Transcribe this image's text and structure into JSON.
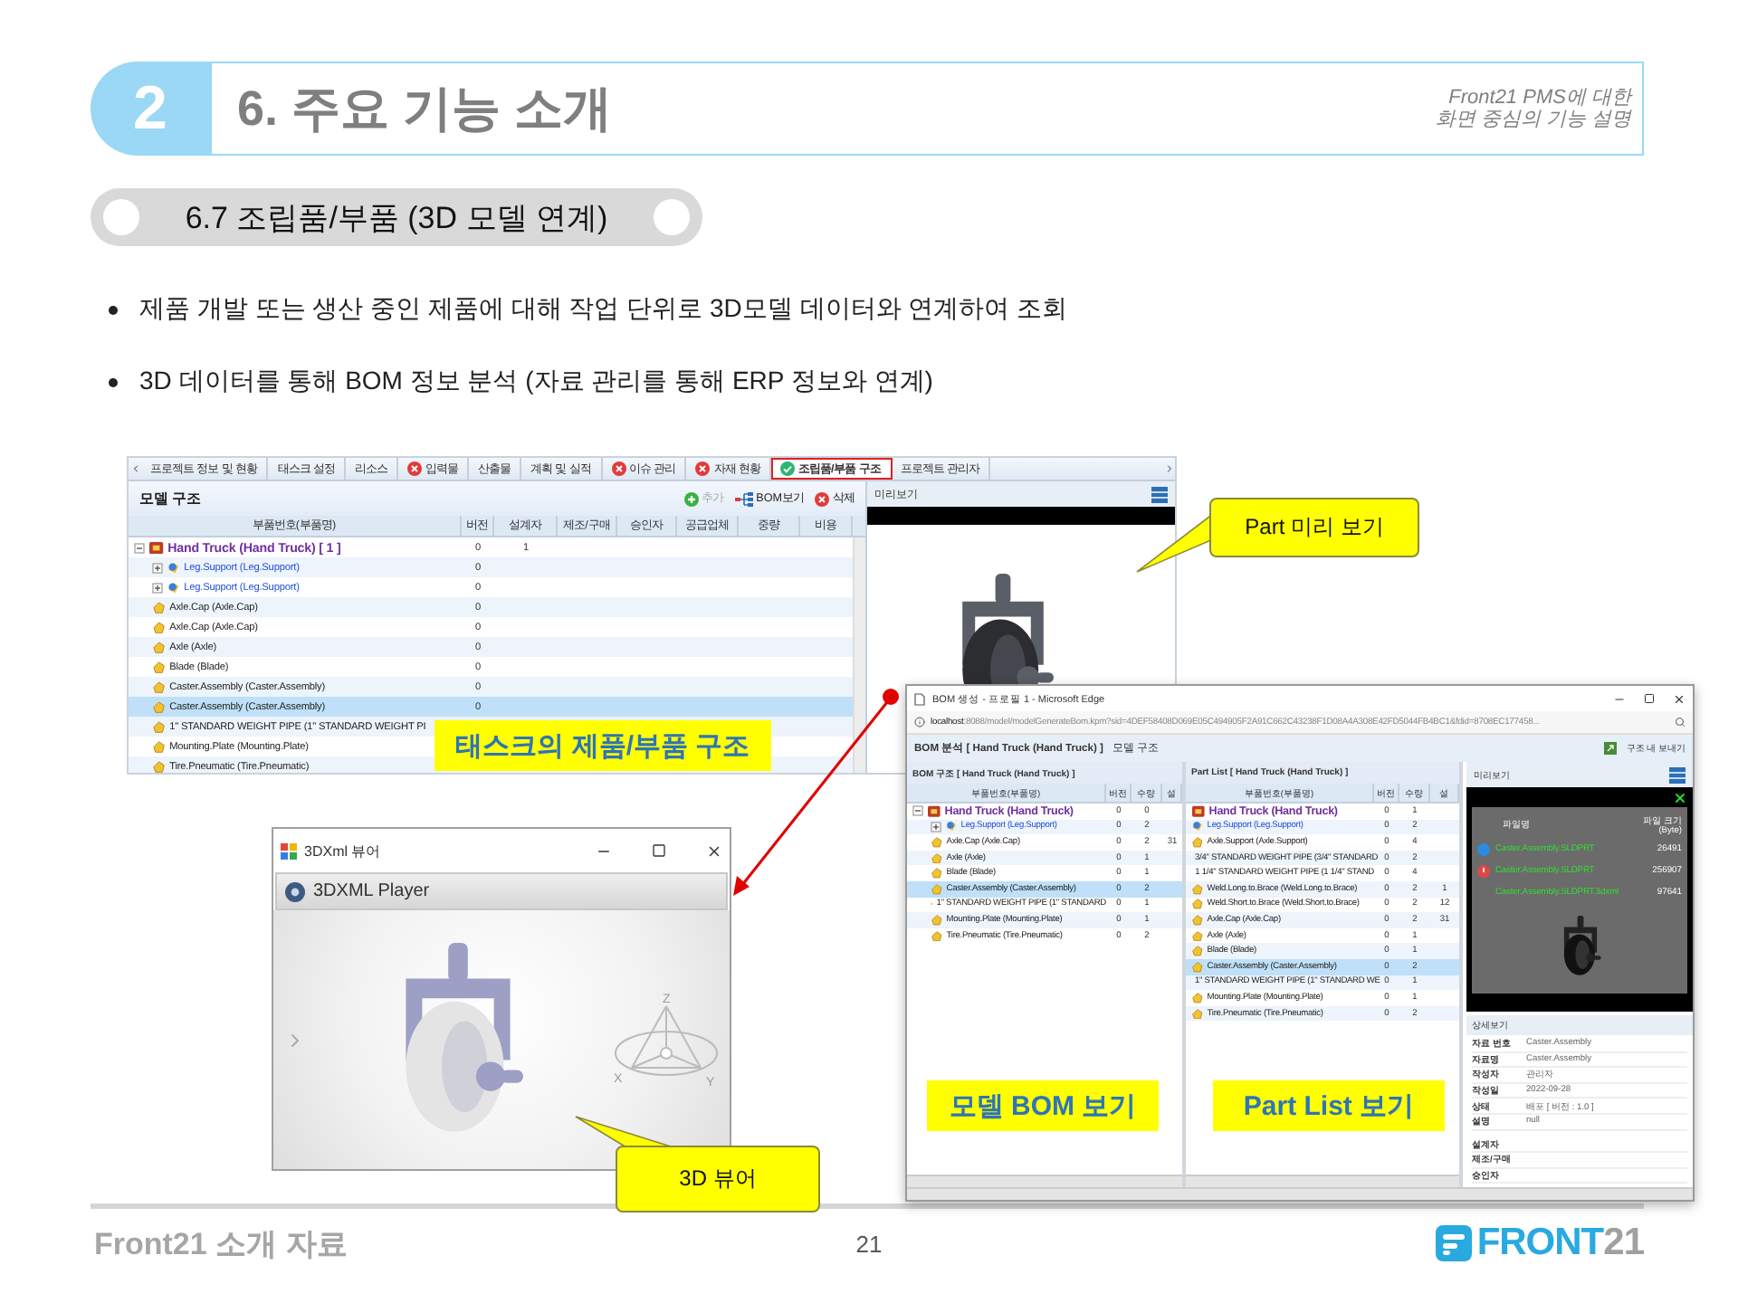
{
  "header": {
    "number": "2",
    "title": "6. 주요 기능 소개",
    "subtitle_lines": [
      "Front21 PMS에 대한",
      "화면 중심의 기능 설명"
    ]
  },
  "section": {
    "title": "6.7 조립품/부품 (3D 모델 연계)"
  },
  "bullets": [
    "제품 개발 또는 생산 중인 제품에 대해 작업 단위로 3D모델 데이터와 연계하여 조회",
    "3D 데이터를 통해 BOM 정보 분석 (자료 관리를 통해 ERP 정보와 연계)"
  ],
  "task_screen": {
    "tabs": [
      {
        "label": "프로젝트 정보 및 현황",
        "kind": "plain",
        "selected": false
      },
      {
        "label": "태스크 설정",
        "kind": "plain",
        "selected": false
      },
      {
        "label": "리소스",
        "kind": "plain",
        "selected": false
      },
      {
        "label": "입력물",
        "kind": "error",
        "selected": false
      },
      {
        "label": "산출물",
        "kind": "plain",
        "selected": false
      },
      {
        "label": "계획 및 실적",
        "kind": "plain",
        "selected": false
      },
      {
        "label": "이슈 관리",
        "kind": "error",
        "selected": false
      },
      {
        "label": "자재 현황",
        "kind": "error",
        "selected": false
      },
      {
        "label": "조립품/부품 구조",
        "kind": "done",
        "selected": true
      },
      {
        "label": "프로젝트 관리자",
        "kind": "plain",
        "selected": false
      }
    ],
    "panel_title": "모델 구조",
    "actions": [
      {
        "label": "추가",
        "kind": "add",
        "disabled": true
      },
      {
        "label": "BOM보기",
        "kind": "tree",
        "disabled": false
      },
      {
        "label": "삭제",
        "kind": "delete",
        "disabled": false
      }
    ],
    "name_column": "부품번호(부품명)",
    "columns": [
      "버전",
      "설계자",
      "제조/구매",
      "승인자",
      "공급업체",
      "중량",
      "비용"
    ],
    "tree": [
      {
        "name": "Hand Truck (Hand Truck) [ 1 ]",
        "kind": "root",
        "expanded": true,
        "selected": false,
        "cells": [
          "0",
          "1"
        ],
        "children": [
          {
            "name": "Leg.Support (Leg.Support)",
            "kind": "assembly",
            "expanded": false,
            "selected": false,
            "cells": [
              "0"
            ]
          },
          {
            "name": "Leg.Support (Leg.Support)",
            "kind": "assembly",
            "expanded": false,
            "selected": false,
            "cells": [
              "0"
            ]
          },
          {
            "name": "Axle.Cap (Axle.Cap)",
            "kind": "part",
            "selected": false,
            "cells": [
              "0"
            ]
          },
          {
            "name": "Axle.Cap (Axle.Cap)",
            "kind": "part",
            "selected": false,
            "cells": [
              "0"
            ]
          },
          {
            "name": "Axle (Axle)",
            "kind": "part",
            "selected": false,
            "cells": [
              "0"
            ]
          },
          {
            "name": "Blade (Blade)",
            "kind": "part",
            "selected": false,
            "cells": [
              "0"
            ]
          },
          {
            "name": "Caster.Assembly (Caster.Assembly)",
            "kind": "part",
            "selected": false,
            "cells": [
              "0"
            ]
          },
          {
            "name": "Caster.Assembly (Caster.Assembly)",
            "kind": "part",
            "selected": true,
            "cells": [
              "0"
            ]
          },
          {
            "name": "1\" STANDARD WEIGHT PIPE (1\" STANDARD WEIGHT PI",
            "kind": "part",
            "selected": false
          },
          {
            "name": "Mounting.Plate (Mounting.Plate)",
            "kind": "part",
            "selected": false
          },
          {
            "name": "Tire.Pneumatic (Tire.Pneumatic)",
            "kind": "part",
            "selected": false
          }
        ]
      }
    ],
    "preview_title": "미리보기"
  },
  "bom_window": {
    "title": "BOM 생성 - 프로필 1 - Microsoft Edge",
    "url_host": "localhost",
    "url_path": ":8088/model/modelGenerateBom.kpm?sid=4DEF58408D069E05C494905F2A91C662C43238F1D08A4A308E42FD5044FB4BC1&fdid=8708EC177458...",
    "heading": "BOM 분석 [ Hand Truck (Hand Truck) ]",
    "heading_sub": "모델 구조",
    "export_label": "구조 내 보내기",
    "bom_panel": {
      "title": "BOM 구조 [ Hand Truck (Hand Truck) ]",
      "name_column": "부품번호(부품명)",
      "columns": [
        "버전",
        "수량",
        "설"
      ],
      "tree": [
        {
          "name": "Hand Truck (Hand Truck)",
          "kind": "root",
          "expanded": true,
          "selected": false,
          "cells": [
            "0",
            "0"
          ],
          "children": [
            {
              "name": "Leg.Support (Leg.Support)",
              "kind": "assembly",
              "expanded": false,
              "selected": false,
              "cells": [
                "0",
                "2"
              ]
            },
            {
              "name": "Axle.Cap (Axle.Cap)",
              "kind": "part",
              "selected": false,
              "cells": [
                "0",
                "2",
                "31"
              ]
            },
            {
              "name": "Axle (Axle)",
              "kind": "part",
              "selected": false,
              "cells": [
                "0",
                "1"
              ]
            },
            {
              "name": "Blade (Blade)",
              "kind": "part",
              "selected": false,
              "cells": [
                "0",
                "1"
              ]
            },
            {
              "name": "Caster.Assembly (Caster.Assembly)",
              "kind": "part",
              "selected": true,
              "cells": [
                "0",
                "2"
              ]
            },
            {
              "name": "1\" STANDARD WEIGHT PIPE (1\" STANDARD",
              "kind": "part",
              "selected": false,
              "cells": [
                "0",
                "1"
              ]
            },
            {
              "name": "Mounting.Plate (Mounting.Plate)",
              "kind": "part",
              "selected": false,
              "cells": [
                "0",
                "1"
              ]
            },
            {
              "name": "Tire.Pneumatic (Tire.Pneumatic)",
              "kind": "part",
              "selected": false,
              "cells": [
                "0",
                "2"
              ]
            }
          ]
        }
      ]
    },
    "part_panel": {
      "title": "Part List [ Hand Truck (Hand Truck) ]",
      "name_column": "부품번호(부품명)",
      "columns": [
        "버전",
        "수량",
        "설"
      ],
      "rows": [
        {
          "name": "Hand Truck (Hand Truck)",
          "kind": "root",
          "selected": false,
          "cells": [
            "0",
            "1"
          ]
        },
        {
          "name": "Leg.Support (Leg.Support)",
          "kind": "assembly",
          "selected": false,
          "cells": [
            "0",
            "2"
          ]
        },
        {
          "name": "Axle.Support (Axle.Support)",
          "kind": "part",
          "selected": false,
          "cells": [
            "0",
            "4"
          ]
        },
        {
          "name": "3/4\" STANDARD WEIGHT PIPE (3/4\" STANDARD",
          "kind": "part",
          "selected": false,
          "cells": [
            "0",
            "2"
          ]
        },
        {
          "name": "1 1/4\" STANDARD WEIGHT PIPE (1 1/4\" STAND",
          "kind": "part",
          "selected": false,
          "cells": [
            "0",
            "4"
          ]
        },
        {
          "name": "Weld.Long.to.Brace (Weld.Long.to.Brace)",
          "kind": "part",
          "selected": false,
          "cells": [
            "0",
            "2",
            "1"
          ]
        },
        {
          "name": "Weld.Short.to.Brace (Weld.Short.to.Brace)",
          "kind": "part",
          "selected": false,
          "cells": [
            "0",
            "2",
            "12"
          ]
        },
        {
          "name": "Axle.Cap (Axle.Cap)",
          "kind": "part",
          "selected": false,
          "cells": [
            "0",
            "2",
            "31"
          ]
        },
        {
          "name": "Axle (Axle)",
          "kind": "part",
          "selected": false,
          "cells": [
            "0",
            "1"
          ]
        },
        {
          "name": "Blade (Blade)",
          "kind": "part",
          "selected": false,
          "cells": [
            "0",
            "1"
          ]
        },
        {
          "name": "Caster.Assembly (Caster.Assembly)",
          "kind": "part",
          "selected": true,
          "cells": [
            "0",
            "2"
          ]
        },
        {
          "name": "1\" STANDARD WEIGHT PIPE (1\" STANDARD WE",
          "kind": "part",
          "selected": false,
          "cells": [
            "0",
            "1"
          ]
        },
        {
          "name": "Mounting.Plate (Mounting.Plate)",
          "kind": "part",
          "selected": false,
          "cells": [
            "0",
            "1"
          ]
        },
        {
          "name": "Tire.Pneumatic (Tire.Pneumatic)",
          "kind": "part",
          "selected": false,
          "cells": [
            "0",
            "2"
          ]
        }
      ]
    },
    "preview": {
      "title": "미리보기",
      "file_columns": [
        "파일명",
        "파일 크기 (Byte)"
      ],
      "files": [
        {
          "name": "Caster.Assembly.SLDPRT",
          "size": "26491",
          "kind": "model"
        },
        {
          "name": "Caster.Assembly.SLDPRT",
          "size": "256907",
          "kind": "alert"
        },
        {
          "name": "Caster.Assembly.SLDPRT.3dxml",
          "size": "97641",
          "kind": "plain"
        }
      ]
    },
    "details": {
      "title": "상세보기",
      "fields": [
        {
          "label": "자료 번호",
          "value": "Caster.Assembly"
        },
        {
          "label": "자료명",
          "value": "Caster.Assembly"
        },
        {
          "label": "작성자",
          "value": "관리자"
        },
        {
          "label": "작성일",
          "value": "2022-09-28"
        },
        {
          "label": "상태",
          "value": "배포 [ 버전 : 1.0 ]"
        },
        {
          "label": "설명",
          "value": "null"
        },
        {
          "label": "설계자"
        },
        {
          "label": "제조/구매"
        },
        {
          "label": "승인자"
        }
      ]
    }
  },
  "viewer_window": {
    "title": "3DXml 뷰어",
    "toolbar_title": "3DXML Player",
    "axes": [
      "Z",
      "X",
      "Y"
    ]
  },
  "callouts": [
    {
      "text": "Part 미리 보기",
      "kind": "pointer"
    },
    {
      "text": "태스크의 제품/부품 구조",
      "kind": "label"
    },
    {
      "text": "모델 BOM 보기",
      "kind": "label"
    },
    {
      "text": "Part List 보기",
      "kind": "label"
    },
    {
      "text": "3D 뷰어",
      "kind": "pointer"
    }
  ],
  "footer": {
    "left": "Front21 소개 자료",
    "page": "21",
    "logo_word": "FRONT",
    "logo_number": "21"
  }
}
